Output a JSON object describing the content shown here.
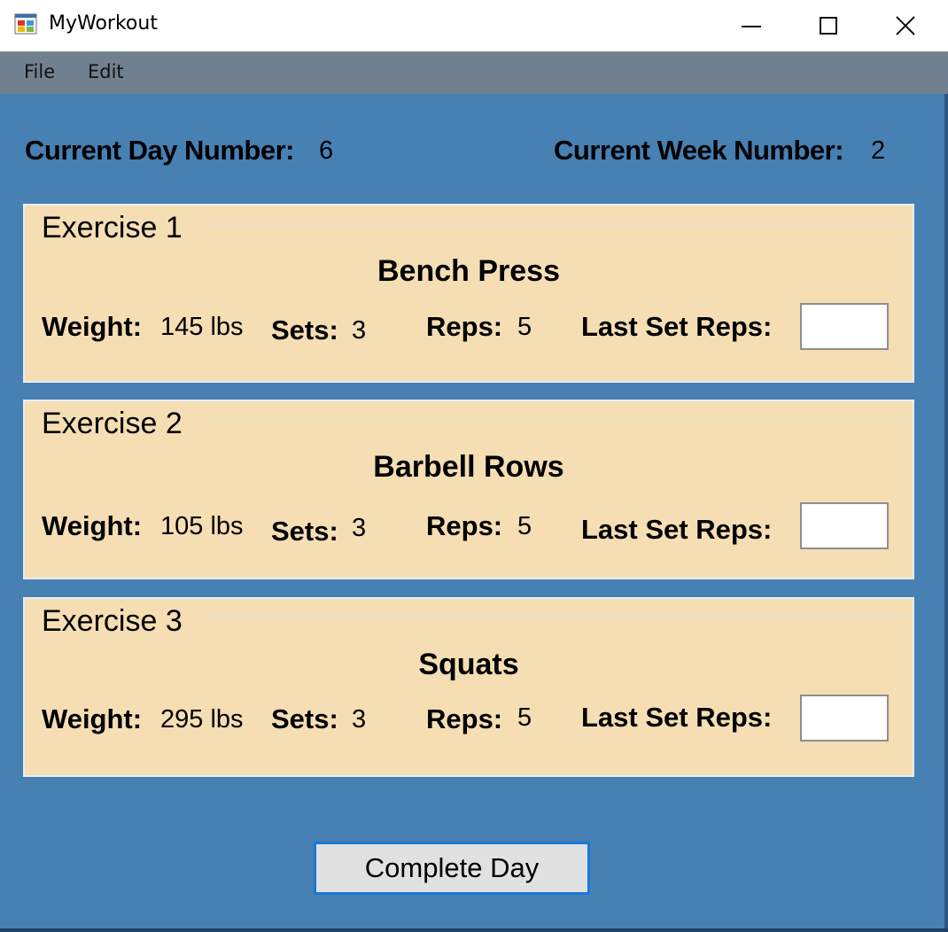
{
  "window": {
    "title": "MyWorkout",
    "minimize_icon": "minimize-icon",
    "maximize_icon": "maximize-icon",
    "close_icon": "close-icon"
  },
  "menu": {
    "file_label": "File",
    "edit_label": "Edit"
  },
  "header": {
    "day_label": "Current Day Number:",
    "day_value": "6",
    "week_label": "Current Week Number:",
    "week_value": "2"
  },
  "exercises": [
    {
      "group_title": "Exercise 1",
      "name": "Bench Press",
      "weight_label": "Weight:",
      "weight_value": "145 lbs",
      "sets_label": "Sets:",
      "sets_value": "3",
      "reps_label": "Reps:",
      "reps_value": "5",
      "last_set_label": "Last Set Reps:",
      "last_set_value": ""
    },
    {
      "group_title": "Exercise 2",
      "name": "Barbell Rows",
      "weight_label": "Weight:",
      "weight_value": "105 lbs",
      "sets_label": "Sets:",
      "sets_value": "3",
      "reps_label": "Reps:",
      "reps_value": "5",
      "last_set_label": "Last Set Reps:",
      "last_set_value": ""
    },
    {
      "group_title": "Exercise 3",
      "name": "Squats",
      "weight_label": "Weight:",
      "weight_value": "295 lbs",
      "sets_label": "Sets:",
      "sets_value": "3",
      "reps_label": "Reps:",
      "reps_value": "5",
      "last_set_label": "Last Set Reps:",
      "last_set_value": ""
    }
  ],
  "actions": {
    "complete_label": "Complete Day"
  },
  "colors": {
    "client_background": "#4780b3",
    "group_background": "#f5deb4",
    "menubar_background": "#70808f",
    "button_focus_border": "#1979d4"
  }
}
